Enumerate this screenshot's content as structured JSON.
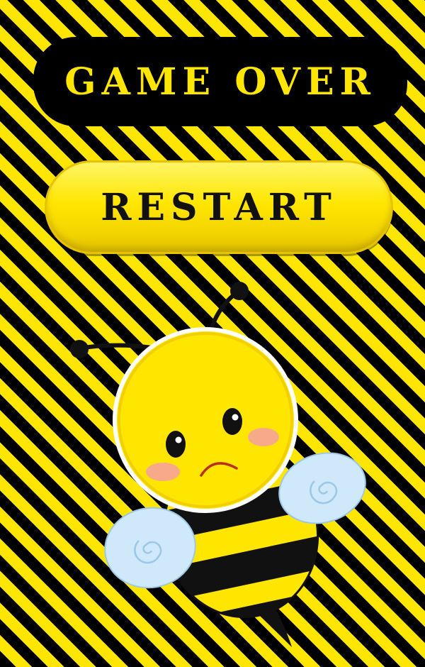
{
  "banner": {
    "title": "GAME OVER"
  },
  "restart": {
    "label": "RESTART"
  },
  "colors": {
    "yellow": "#ffe600",
    "black": "#000000",
    "wing": "#cfe8fa",
    "cheek": "#f7a98a"
  },
  "mascot": {
    "icon": "sad-bee-icon"
  }
}
